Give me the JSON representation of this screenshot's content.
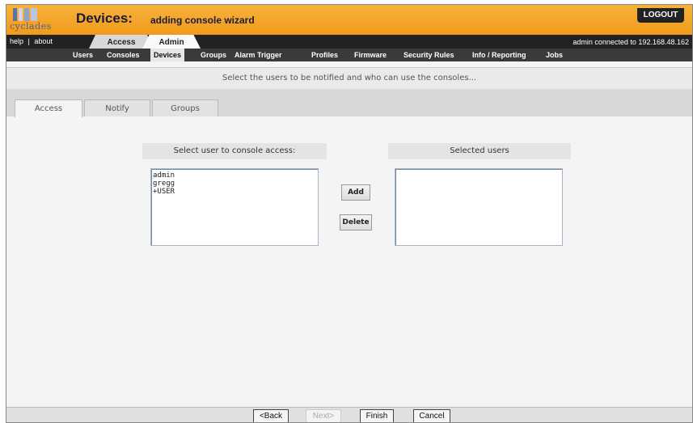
{
  "header": {
    "logo_text": "cyclades",
    "title": "Devices:",
    "subtitle": "adding console wizard",
    "logout_label": "LOGOUT"
  },
  "topnav": {
    "help": "help",
    "separator": "|",
    "about": "about",
    "tabs": [
      "Access",
      "Admin"
    ],
    "connection": "admin connected to 192.168.48.162"
  },
  "subnav": {
    "items": [
      "Users",
      "Consoles",
      "Devices",
      "Groups",
      "Alarm Trigger",
      "Profiles",
      "Firmware",
      "Security Rules",
      "Info / Reporting",
      "Jobs"
    ],
    "active": "Devices"
  },
  "message": "Select the users to be notified and who can use the consoles...",
  "content_tabs": [
    "Access",
    "Notify",
    "Groups"
  ],
  "left_panel": {
    "header": "Select user to console access:",
    "items": [
      "admin",
      "gregg",
      "+USER"
    ]
  },
  "right_panel": {
    "header": "Selected users",
    "items": []
  },
  "actions": {
    "add": "Add",
    "delete": "Delete"
  },
  "footer": {
    "back": "<Back",
    "next": "Next>",
    "finish": "Finish",
    "cancel": "Cancel"
  },
  "colors": {
    "header_orange": "#f09a1c",
    "nav_dark": "#222222",
    "subnav": "#3a3a3a"
  }
}
